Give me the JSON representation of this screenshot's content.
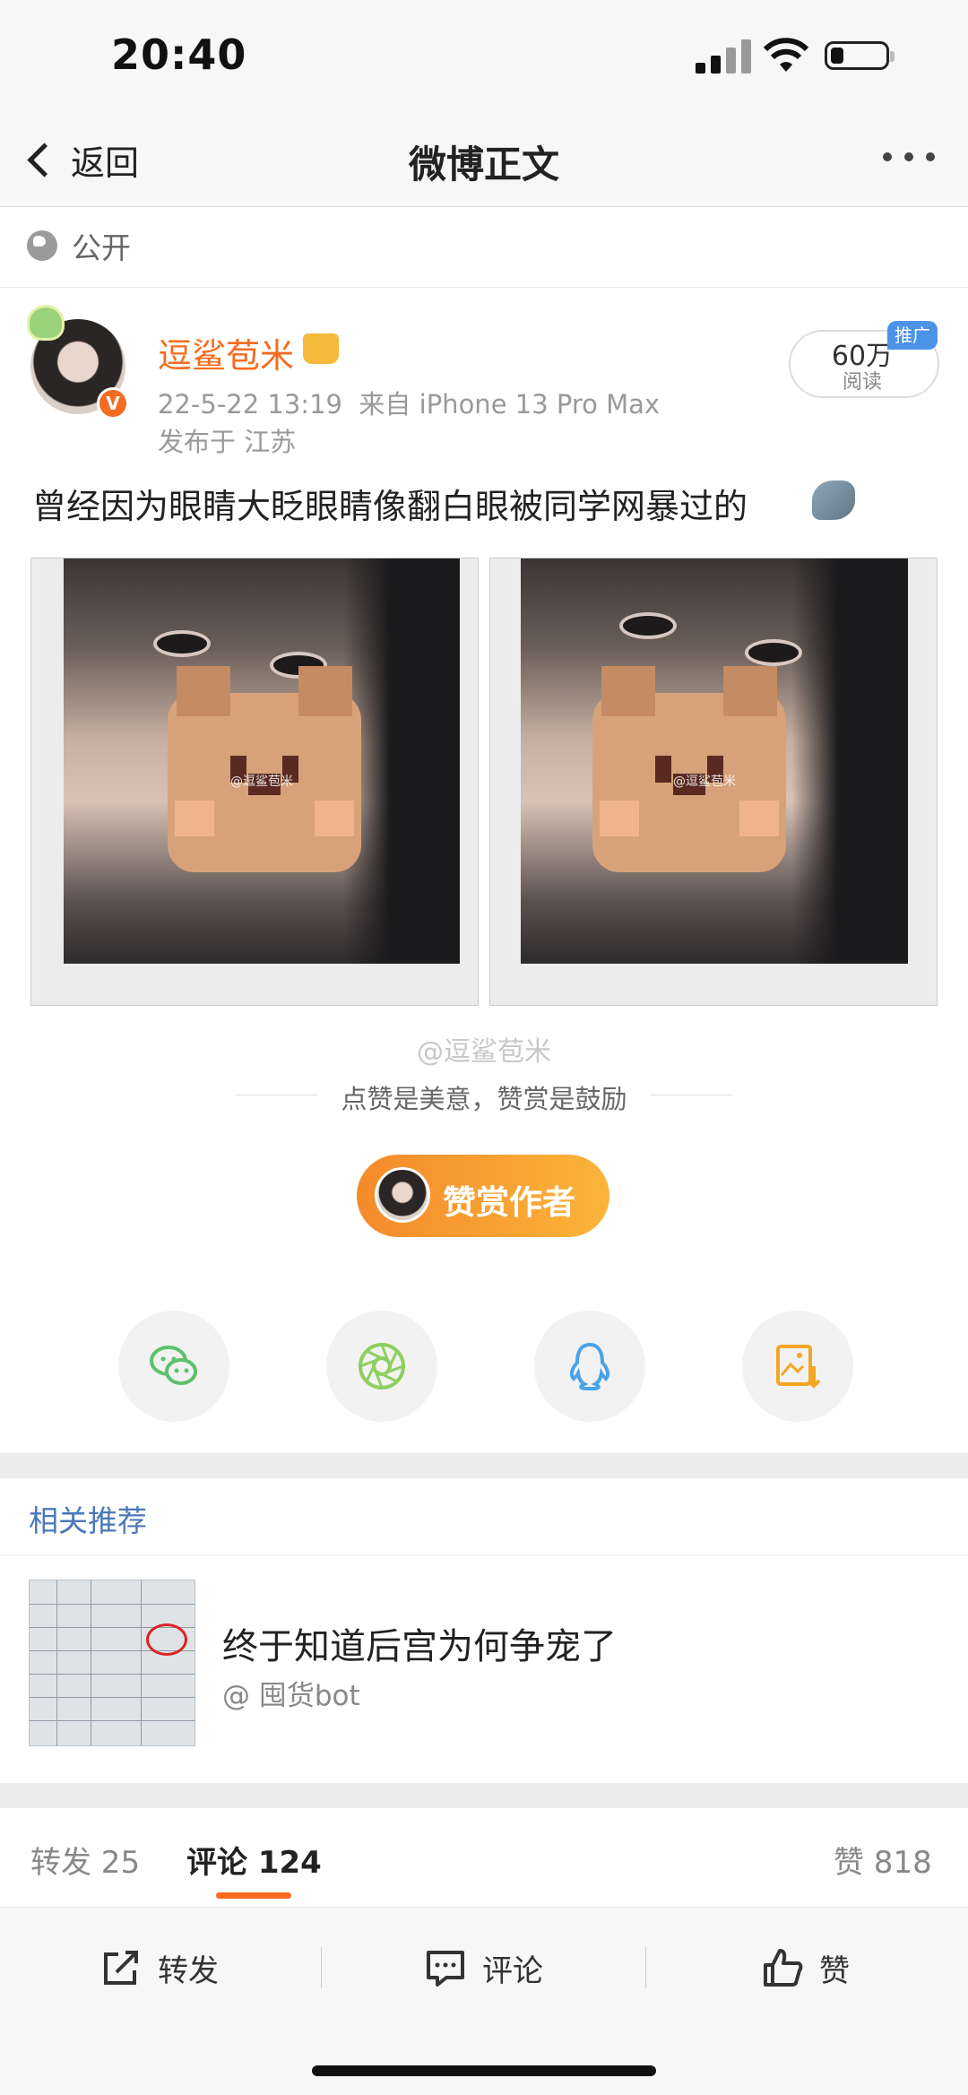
{
  "status_bar": {
    "time": "20:40"
  },
  "nav": {
    "back_label": "返回",
    "title": "微博正文"
  },
  "post": {
    "visibility": "公开",
    "author": "逗鲨苞米",
    "timestamp": "22-5-22 13:19",
    "source": "来自 iPhone 13 Pro Max",
    "location": "发布于 江苏",
    "read_count": "60万",
    "read_label": "阅读",
    "promo_badge": "推广",
    "text": "曾经因为眼睛大眨眼睛像翻白眼被同学网暴过的",
    "image_watermark": "@逗鲨苞米",
    "photo_watermark": "@逗鲨苞米"
  },
  "reward": {
    "tagline": "点赞是美意，赞赏是鼓励",
    "button_label": "赞赏作者"
  },
  "share_icons": [
    "wechat-icon",
    "moments-icon",
    "qq-icon",
    "save-image-icon"
  ],
  "related": {
    "section_title": "相关推荐",
    "item": {
      "headline": "终于知道后宫为何争宠了",
      "source": "@ 囤货bot"
    }
  },
  "stats_tabs": {
    "repost": "转发 25",
    "comment": "评论 124",
    "like": "赞 818"
  },
  "bottom_bar": {
    "repost": "转发",
    "comment": "评论",
    "like": "赞"
  },
  "colors": {
    "accent_orange": "#f76b1c",
    "link_blue": "#4a78b8",
    "promo_blue": "#4b93e6"
  }
}
